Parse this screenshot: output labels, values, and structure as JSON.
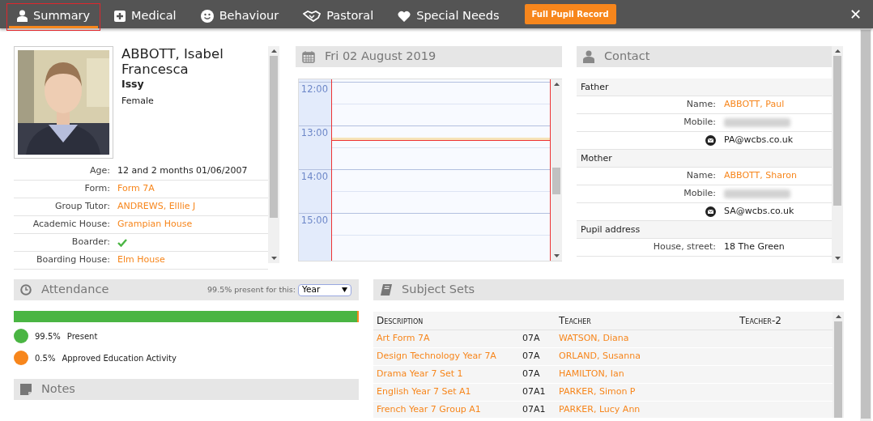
{
  "tabs": [
    {
      "label": "Summary",
      "selected": true,
      "highlighted": true
    },
    {
      "label": "Medical",
      "selected": false,
      "highlighted": false
    },
    {
      "label": "Behaviour",
      "selected": false,
      "highlighted": false
    },
    {
      "label": "Pastoral",
      "selected": false,
      "highlighted": false
    },
    {
      "label": "Special Needs",
      "selected": false,
      "highlighted": false
    }
  ],
  "full_record_button": "Full Pupil Record",
  "close": "✕",
  "pupil": {
    "name": "ABBOTT, Isabel Francesca",
    "preferred_name": "Issy",
    "gender": "Female",
    "fields": [
      {
        "label": "Age:",
        "kind": "text",
        "value": "12 and 2 months 01/06/2007"
      },
      {
        "label": "Form:",
        "kind": "link",
        "value": "Form 7A"
      },
      {
        "label": "Group Tutor:",
        "kind": "link",
        "value": "ANDREWS, Elllie J"
      },
      {
        "label": "Academic House:",
        "kind": "link",
        "value": "Grampian House"
      },
      {
        "label": "Boarder:",
        "kind": "check",
        "checked": true
      },
      {
        "label": "Boarding House:",
        "kind": "link",
        "value": "Elm House"
      }
    ]
  },
  "calendar": {
    "title": "Fri 02 August 2019",
    "times": [
      "12:00",
      "13:00",
      "14:00",
      "15:00"
    ]
  },
  "contact": {
    "title": "Contact",
    "groups": [
      {
        "heading": "Father",
        "rows": [
          {
            "kind": "name",
            "label": "Name:",
            "value": "ABBOTT, Paul"
          },
          {
            "kind": "blurred",
            "label": "Mobile:"
          },
          {
            "kind": "email",
            "value": "PA@wcbs.co.uk"
          }
        ]
      },
      {
        "heading": "Mother",
        "rows": [
          {
            "kind": "name",
            "label": "Name:",
            "value": "ABBOTT, Sharon"
          },
          {
            "kind": "blurred",
            "label": "Mobile:"
          },
          {
            "kind": "email",
            "value": "SA@wcbs.co.uk"
          }
        ]
      },
      {
        "heading": "Pupil address",
        "rows": [
          {
            "kind": "text",
            "label": "House, street:",
            "value": "18 The Green"
          }
        ]
      }
    ]
  },
  "attendance": {
    "title": "Attendance",
    "summary": "99.5% present for this:",
    "period": "Year",
    "level": 0.995,
    "legend": [
      {
        "percent": "99.5%",
        "label": "Present",
        "color": "#4ab543"
      },
      {
        "percent": "0.5%",
        "label": "Approved Education Activity",
        "color": "#f7861c"
      }
    ]
  },
  "notes": {
    "title": "Notes"
  },
  "subject_sets": {
    "title": "Subject Sets",
    "columns": [
      "Description",
      "Teacher",
      "Teacher-2"
    ],
    "rows": [
      {
        "description": "Art Form 7A",
        "code": "07A",
        "teacher": "WATSON, Diana"
      },
      {
        "description": "Design Technology Year 7A",
        "code": "07A",
        "teacher": "ORLAND, Susanna"
      },
      {
        "description": "Drama Year 7 Set 1",
        "code": "07A",
        "teacher": "HAMILTON, Ian"
      },
      {
        "description": "English Year 7 Set A1",
        "code": "07A1",
        "teacher": "PARKER, Simon P"
      },
      {
        "description": "French Year 7 Group A1",
        "code": "07A1",
        "teacher": "PARKER, Lucy Ann"
      }
    ]
  }
}
